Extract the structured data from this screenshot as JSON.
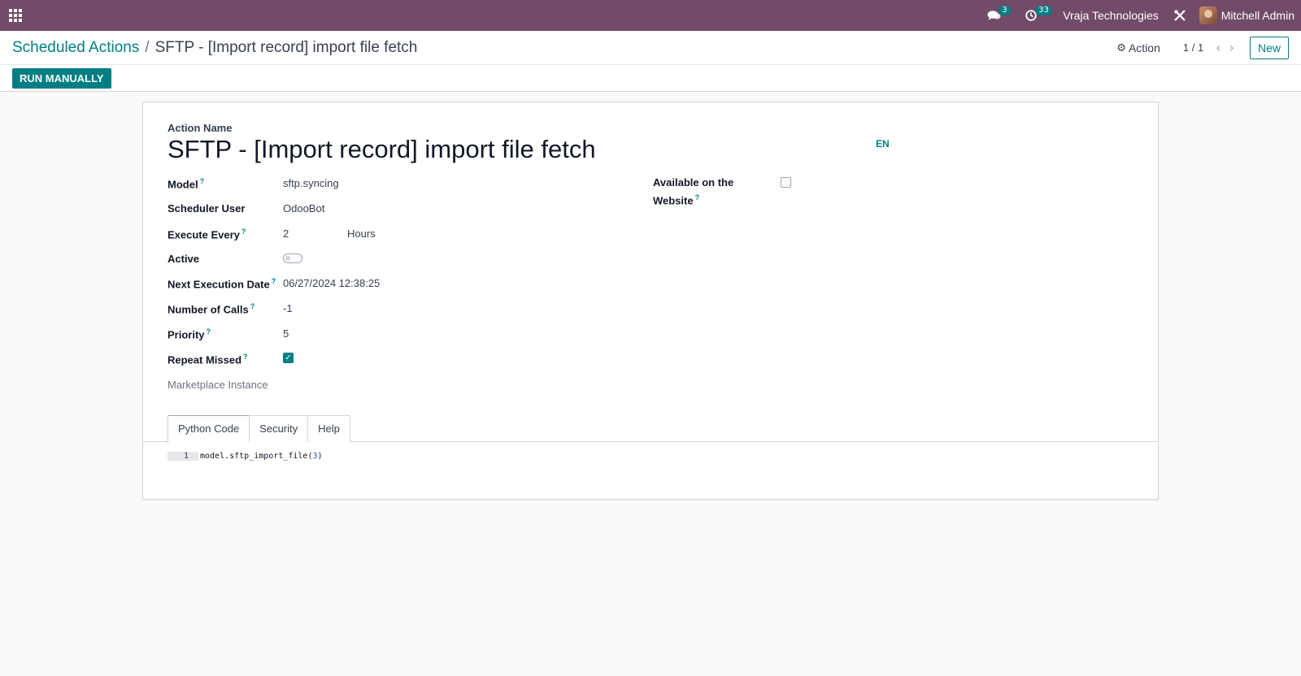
{
  "navbar": {
    "messages_count": "3",
    "activities_count": "33",
    "company": "Vraja Technologies",
    "user": "Mitchell Admin"
  },
  "breadcrumb": {
    "parent": "Scheduled Actions",
    "separator": "/",
    "current": "SFTP - [Import record] import file fetch"
  },
  "control": {
    "action_label": "Action",
    "pager": "1 / 1",
    "new_label": "New"
  },
  "statusbar": {
    "run_label": "RUN MANUALLY"
  },
  "form": {
    "name_label": "Action Name",
    "name_value": "SFTP - [Import record] import file fetch",
    "lang": "EN",
    "model_label": "Model",
    "model_value": "sftp.syncing",
    "user_label": "Scheduler User",
    "user_value": "OdooBot",
    "interval_label": "Execute Every",
    "interval_number": "2",
    "interval_unit": "Hours",
    "active_label": "Active",
    "active_value": false,
    "next_date_label": "Next Execution Date",
    "next_date_value": "06/27/2024 12:38:25",
    "calls_label": "Number of Calls",
    "calls_value": "-1",
    "priority_label": "Priority",
    "priority_value": "5",
    "repeat_label": "Repeat Missed",
    "repeat_value": true,
    "website_label_line1": "Available on the",
    "website_label_line2": "Website",
    "website_value": false,
    "marketplace_label": "Marketplace Instance",
    "help_mark": "?"
  },
  "tabs": [
    {
      "label": "Python Code",
      "active": true
    },
    {
      "label": "Security",
      "active": false
    },
    {
      "label": "Help",
      "active": false
    }
  ],
  "code": {
    "line_number": "1",
    "text_prefix": "model.sftp_import_file(",
    "text_number": "3",
    "text_suffix": ")"
  },
  "colors": {
    "navbar": "#714b67",
    "accent": "#017e84"
  }
}
